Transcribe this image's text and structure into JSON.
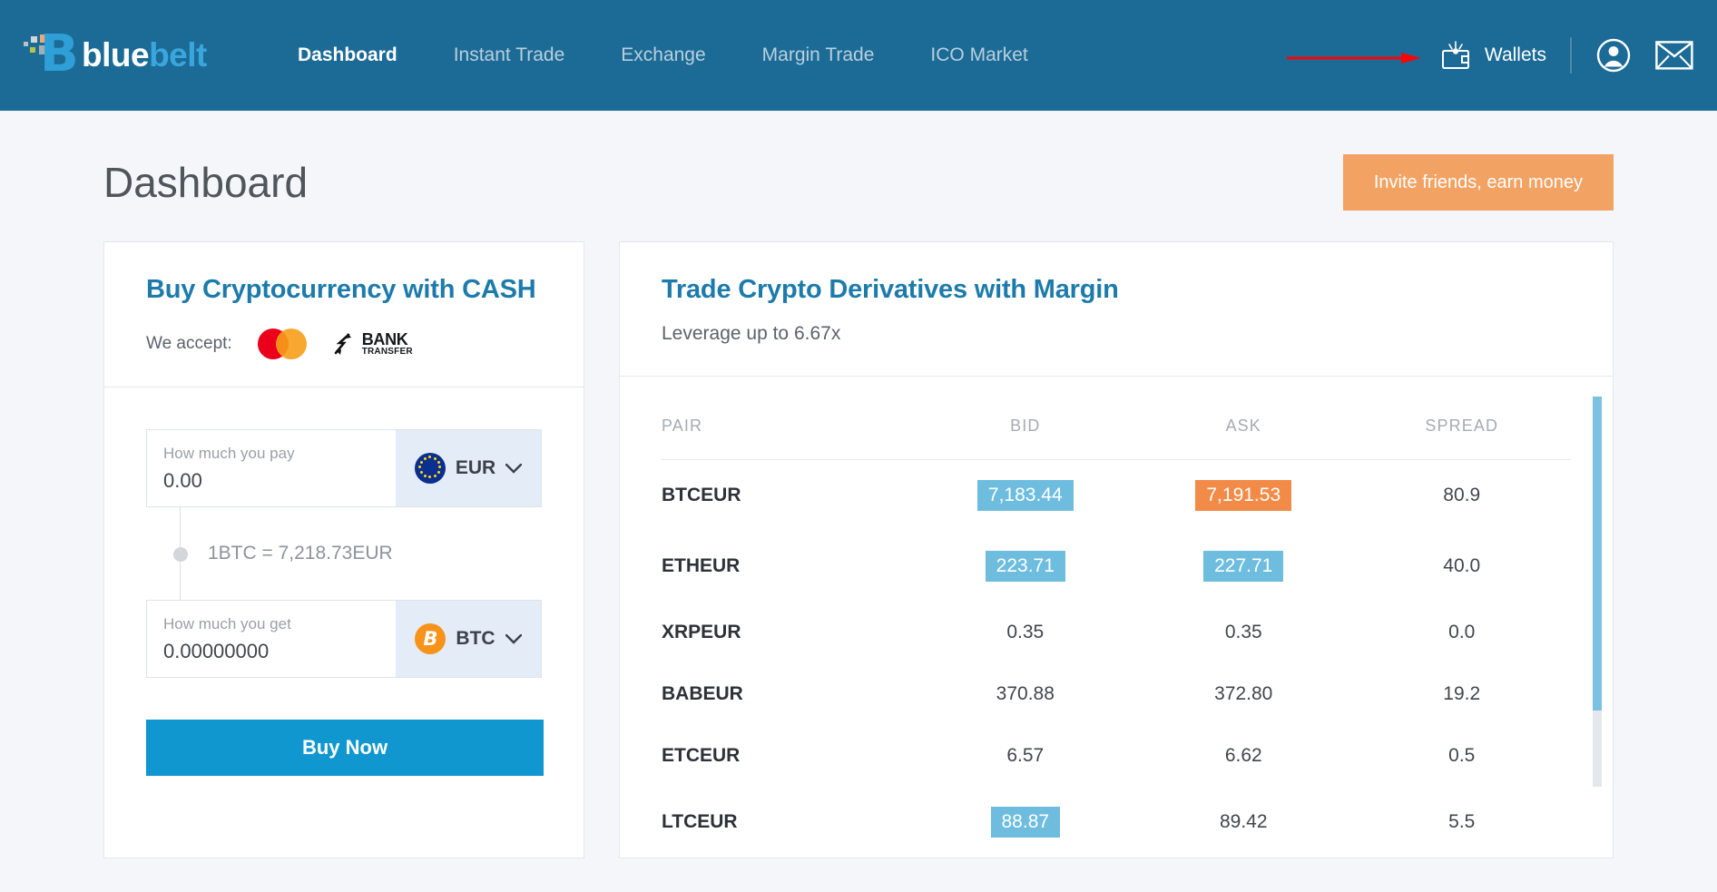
{
  "header": {
    "logo": {
      "part1": "blue",
      "part2": "belt",
      "icon": "bluebelt-logo-icon"
    },
    "nav": [
      {
        "label": "Dashboard",
        "active": true
      },
      {
        "label": "Instant Trade",
        "active": false
      },
      {
        "label": "Exchange",
        "active": false
      },
      {
        "label": "Margin Trade",
        "active": false
      },
      {
        "label": "ICO Market",
        "active": false
      }
    ],
    "wallets_label": "Wallets",
    "wallet_icon": "wallet-icon",
    "account_icon": "user-avatar-icon",
    "messages_icon": "envelope-icon",
    "annotation_arrow": "red-arrow-pointing-to-wallets",
    "bar_color": "#1b6b96"
  },
  "page": {
    "title": "Dashboard",
    "invite_button": "Invite friends, earn money",
    "invite_color": "#f2a262"
  },
  "buy_card": {
    "title": "Buy Cryptocurrency with CASH",
    "accept_label": "We accept:",
    "payment_methods": [
      {
        "name": "mastercard-icon"
      },
      {
        "name": "bank-transfer-icon",
        "line1": "BANK",
        "line2": "TRANSFER"
      }
    ],
    "pay_field": {
      "label": "How much you pay",
      "value": "0.00",
      "currency": "EUR",
      "currency_icon": "eu-flag-icon"
    },
    "rate_text": "1BTC = 7,218.73EUR",
    "get_field": {
      "label": "How much you get",
      "value": "0.00000000",
      "currency": "BTC",
      "currency_icon": "bitcoin-icon"
    },
    "buy_button": "Buy Now",
    "buy_button_color": "#1097cf"
  },
  "margin_card": {
    "title": "Trade Crypto Derivatives with Margin",
    "subtitle": "Leverage up to 6.67x",
    "columns": [
      "PAIR",
      "BID",
      "ASK",
      "SPREAD"
    ],
    "rows": [
      {
        "pair": "BTCEUR",
        "bid": "7,183.44",
        "ask": "7,191.53",
        "spread": "80.9",
        "bid_chip": "blue",
        "ask_chip": "orange"
      },
      {
        "pair": "ETHEUR",
        "bid": "223.71",
        "ask": "227.71",
        "spread": "40.0",
        "bid_chip": "blue",
        "ask_chip": "blue"
      },
      {
        "pair": "XRPEUR",
        "bid": "0.35",
        "ask": "0.35",
        "spread": "0.0",
        "bid_chip": "none",
        "ask_chip": "none"
      },
      {
        "pair": "BABEUR",
        "bid": "370.88",
        "ask": "372.80",
        "spread": "19.2",
        "bid_chip": "none",
        "ask_chip": "none"
      },
      {
        "pair": "ETCEUR",
        "bid": "6.57",
        "ask": "6.62",
        "spread": "0.5",
        "bid_chip": "none",
        "ask_chip": "none"
      },
      {
        "pair": "LTCEUR",
        "bid": "88.87",
        "ask": "89.42",
        "spread": "5.5",
        "bid_chip": "blue",
        "ask_chip": "none"
      }
    ],
    "chip_blue": "#6ebddf",
    "chip_orange": "#f28b47"
  }
}
